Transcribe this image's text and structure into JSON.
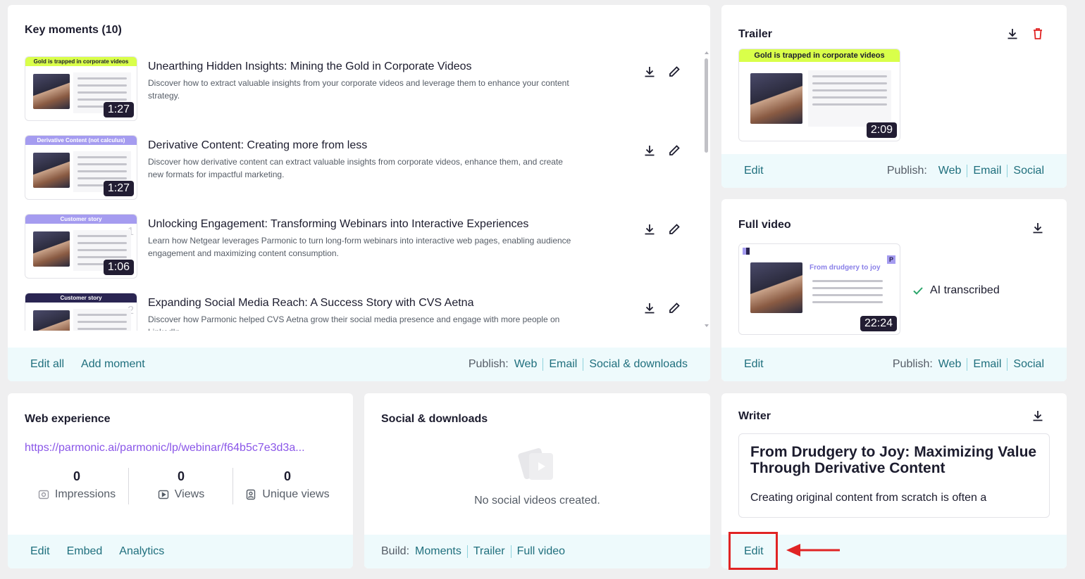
{
  "key_moments": {
    "title": "Key moments (10)",
    "items": [
      {
        "title": "Unearthing Hidden Insights: Mining the Gold in Corporate Videos",
        "description": "Discover how to extract valuable insights from your corporate videos and leverage them to enhance your content strategy.",
        "thumb_band": "Gold is trapped in corporate videos",
        "band_color": "#d9ff4a",
        "duration": "1:27",
        "num": ""
      },
      {
        "title": "Derivative Content: Creating more from less",
        "description": "Discover how derivative content can extract valuable insights from corporate videos, enhance them, and create new formats for impactful marketing.",
        "thumb_band": "Derivative Content (not calculus)",
        "band_color": "#a59cf0",
        "duration": "1:27",
        "num": ""
      },
      {
        "title": "Unlocking Engagement: Transforming Webinars into Interactive Experiences",
        "description": "Learn how Netgear leverages Parmonic to turn long-form webinars into interactive web pages, enabling audience engagement and maximizing content consumption.",
        "thumb_band": "Customer story",
        "band_color": "#a59cf0",
        "duration": "1:06",
        "num": "1"
      },
      {
        "title": "Expanding Social Media Reach: A Success Story with CVS Aetna",
        "description": "Discover how Parmonic helped CVS Aetna grow their social media presence and engage with more people on LinkedIn.",
        "thumb_band": "Customer story",
        "band_color": "#2a2552",
        "duration": "",
        "num": "2"
      }
    ],
    "footer": {
      "edit_all": "Edit all",
      "add_moment": "Add moment",
      "publish_label": "Publish:",
      "web": "Web",
      "email": "Email",
      "social": "Social & downloads"
    }
  },
  "trailer": {
    "title": "Trailer",
    "thumb_band": "Gold is trapped in corporate videos",
    "duration": "2:09",
    "footer": {
      "edit": "Edit",
      "publish_label": "Publish:",
      "web": "Web",
      "email": "Email",
      "social": "Social"
    }
  },
  "full_video": {
    "title": "Full video",
    "duration": "22:24",
    "slide_title": "From drudgery to joy",
    "ai_status": "AI transcribed",
    "footer": {
      "edit": "Edit",
      "publish_label": "Publish:",
      "web": "Web",
      "email": "Email",
      "social": "Social"
    }
  },
  "web_experience": {
    "title": "Web experience",
    "url": "https://parmonic.ai/parmonic/lp/webinar/f64b5c7e3d3a...",
    "stats": [
      {
        "value": "0",
        "label": "Impressions",
        "icon": "eye-icon"
      },
      {
        "value": "0",
        "label": "Views",
        "icon": "play-icon"
      },
      {
        "value": "0",
        "label": "Unique views",
        "icon": "user-icon"
      }
    ],
    "footer": {
      "edit": "Edit",
      "embed": "Embed",
      "analytics": "Analytics"
    }
  },
  "social_downloads": {
    "title": "Social & downloads",
    "empty_text": "No social videos created.",
    "footer": {
      "build_label": "Build:",
      "moments": "Moments",
      "trailer": "Trailer",
      "full_video": "Full video"
    }
  },
  "writer": {
    "title": "Writer",
    "doc_title": "From Drudgery to Joy: Maximizing Value Through Derivative Content",
    "doc_excerpt": "Creating original content from scratch is often a",
    "footer": {
      "edit": "Edit"
    }
  },
  "colors": {
    "accent": "#1f6f7d",
    "highlight": "#e02424",
    "footer_bg": "#eefafc"
  }
}
